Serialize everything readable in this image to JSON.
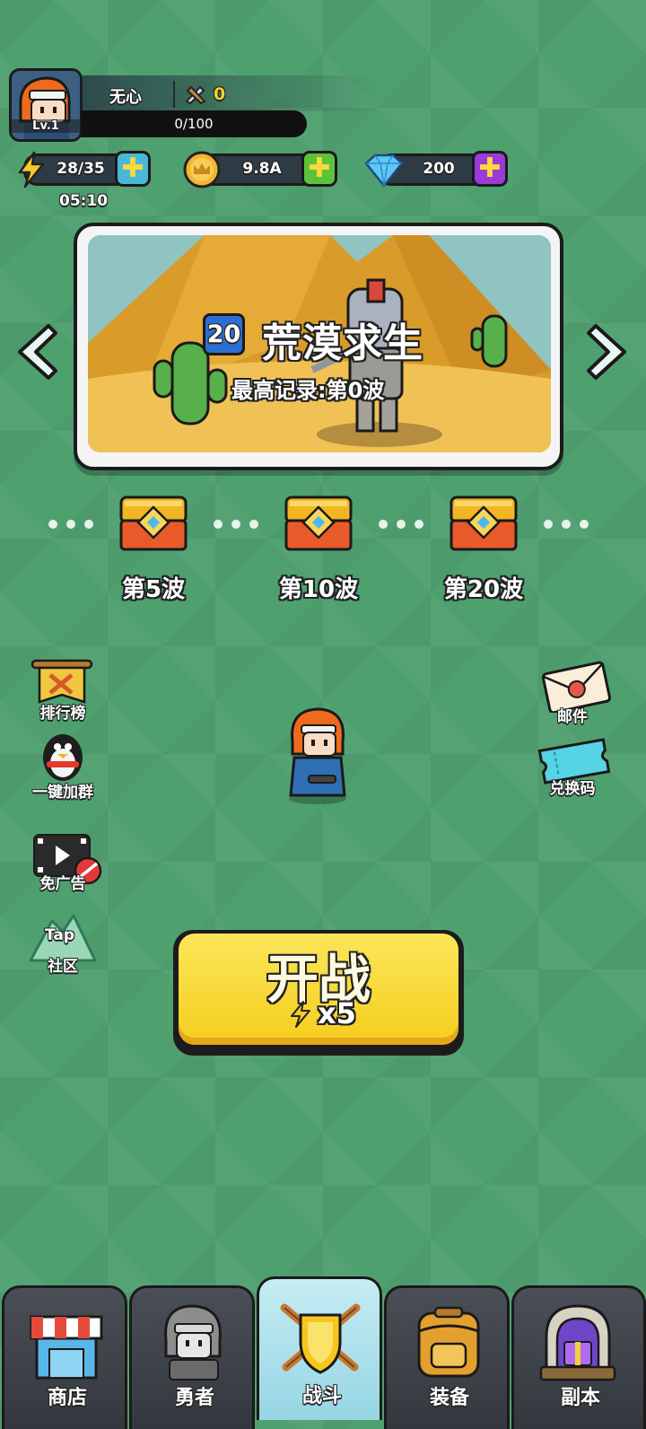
{
  "player": {
    "name": "无心",
    "level": "Lv.1",
    "power": "0",
    "exp": "0/100"
  },
  "resources": {
    "energy": "28/35",
    "energy_timer": "05:10",
    "gold": "9.8A",
    "gems": "200"
  },
  "stage": {
    "number": "20",
    "title": "荒漠求生",
    "record": "最高记录:第0波"
  },
  "rewards": [
    {
      "label": "第5波"
    },
    {
      "label": "第10波"
    },
    {
      "label": "第20波"
    }
  ],
  "side_left": {
    "ranking": "排行榜",
    "join_group": "一键加群",
    "no_ads": "免广告",
    "community": "社区",
    "community_logo": "Tap"
  },
  "side_right": {
    "mail": "邮件",
    "redeem": "兑换码"
  },
  "battle": {
    "label": "开战",
    "cost": "x5"
  },
  "nav": {
    "tabs": [
      {
        "label": "商店",
        "icon": "shop-icon"
      },
      {
        "label": "勇者",
        "icon": "hero-icon"
      },
      {
        "label": "战斗",
        "icon": "battle-icon",
        "active": true
      },
      {
        "label": "装备",
        "icon": "backpack-icon"
      },
      {
        "label": "副本",
        "icon": "dungeon-icon"
      }
    ]
  },
  "colors": {
    "background": "#4fa06f",
    "battle_button": "#f5cd1d",
    "energy_plus": "#49b8d8",
    "gold_plus": "#5cc23a",
    "gem_plus": "#9b3ad8"
  }
}
